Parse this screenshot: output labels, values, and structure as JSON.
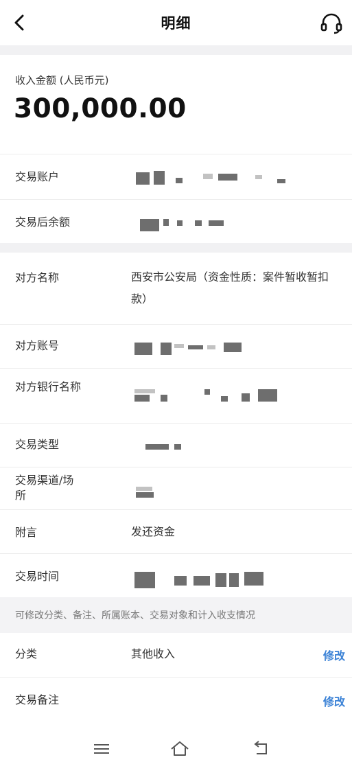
{
  "header": {
    "title": "明细",
    "back_icon": "chevron-left-icon",
    "support_icon": "headset-icon"
  },
  "amount": {
    "label": "收入金额 (人民币元)",
    "value": "300,000.00"
  },
  "details": {
    "account_label": "交易账户",
    "balance_label": "交易后余额",
    "counterparty_name_label": "对方名称",
    "counterparty_name_value": "西安市公安局（资金性质：案件暂收暂扣款）",
    "counterparty_account_label": "对方账号",
    "counterparty_bank_label": "对方银行名称",
    "type_label": "交易类型",
    "channel_label": "交易渠道/场所",
    "memo_label": "附言",
    "memo_value": "发还资金",
    "time_label": "交易时间"
  },
  "note": {
    "text": "可修改分类、备注、所属账本、交易对象和计入收支情况"
  },
  "editable": {
    "category_label": "分类",
    "category_value": "其他收入",
    "category_edit": "修改",
    "remark_label": "交易备注",
    "remark_edit": "修改"
  },
  "colors": {
    "link": "#3b82d6",
    "divider_bg": "#f1f1f3"
  },
  "nav": {
    "menu_icon": "menu-icon",
    "home_icon": "home-icon",
    "back_icon": "return-icon"
  }
}
